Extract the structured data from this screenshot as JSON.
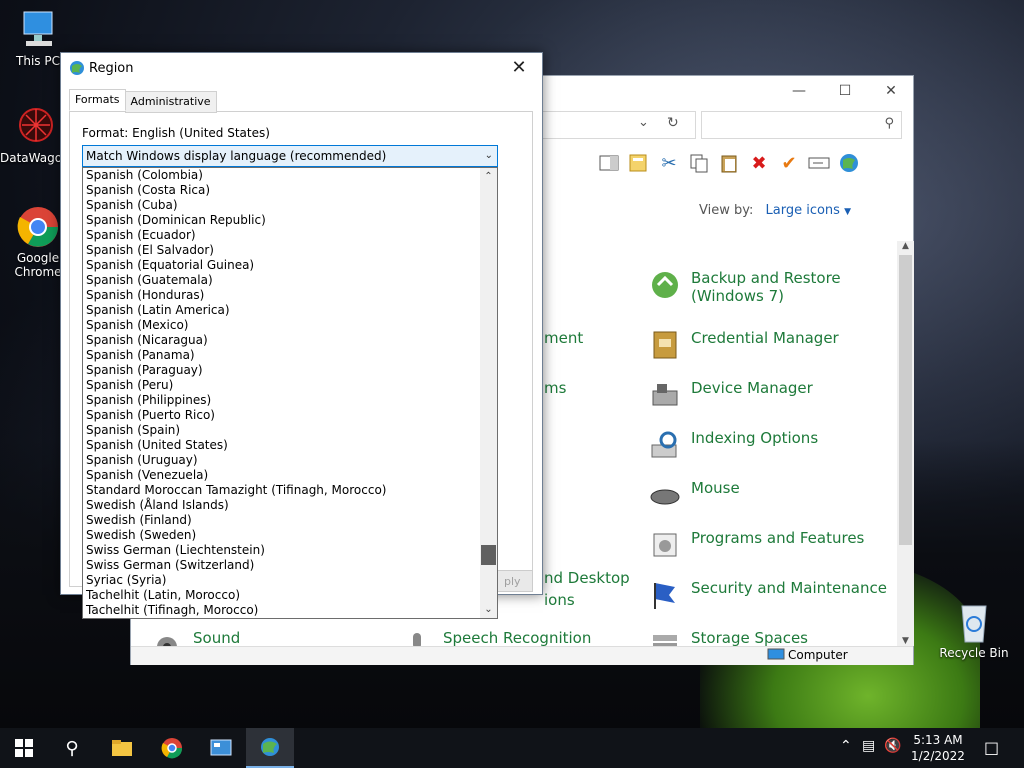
{
  "desktop": {
    "icons": [
      {
        "label": "This PC"
      },
      {
        "label": "DataWagon"
      },
      {
        "label": "Google Chrome"
      },
      {
        "label": "Recycle Bin"
      }
    ]
  },
  "explorer": {
    "view_by_label": "View by:",
    "view_by_value": "Large icons",
    "items": [
      {
        "label": "Backup and Restore (Windows 7)"
      },
      {
        "label": "Credential Manager"
      },
      {
        "label": "Device Manager"
      },
      {
        "label": "Indexing Options"
      },
      {
        "label": "Mouse"
      },
      {
        "label": "Programs and Features"
      },
      {
        "label": "Security and Maintenance"
      },
      {
        "label": "Storage Spaces"
      },
      {
        "label": "Sound"
      },
      {
        "label": "Speech Recognition"
      }
    ],
    "partial_labels": [
      "ment",
      "ms",
      "nd Desktop",
      "ions"
    ],
    "status_computer": "Computer"
  },
  "region": {
    "title": "Region",
    "tabs": [
      {
        "label": "Formats"
      },
      {
        "label": "Administrative"
      }
    ],
    "format_label": "Format: English (United States)",
    "combo_value": "Match Windows display language (recommended)",
    "apply_label": "ply",
    "list": [
      "Spanish (Colombia)",
      "Spanish (Costa Rica)",
      "Spanish (Cuba)",
      "Spanish (Dominican Republic)",
      "Spanish (Ecuador)",
      "Spanish (El Salvador)",
      "Spanish (Equatorial Guinea)",
      "Spanish (Guatemala)",
      "Spanish (Honduras)",
      "Spanish (Latin America)",
      "Spanish (Mexico)",
      "Spanish (Nicaragua)",
      "Spanish (Panama)",
      "Spanish (Paraguay)",
      "Spanish (Peru)",
      "Spanish (Philippines)",
      "Spanish (Puerto Rico)",
      "Spanish (Spain)",
      "Spanish (United States)",
      "Spanish (Uruguay)",
      "Spanish (Venezuela)",
      "Standard Moroccan Tamazight (Tifinagh, Morocco)",
      "Swedish (Åland Islands)",
      "Swedish (Finland)",
      "Swedish (Sweden)",
      "Swiss German (Liechtenstein)",
      "Swiss German (Switzerland)",
      "Syriac (Syria)",
      "Tachelhit (Latin, Morocco)",
      "Tachelhit (Tifinagh, Morocco)"
    ]
  },
  "taskbar": {
    "time": "5:13 AM",
    "date": "1/2/2022"
  },
  "colors": {
    "accent": "#0078d7",
    "cp_link": "#1e7a3a"
  }
}
